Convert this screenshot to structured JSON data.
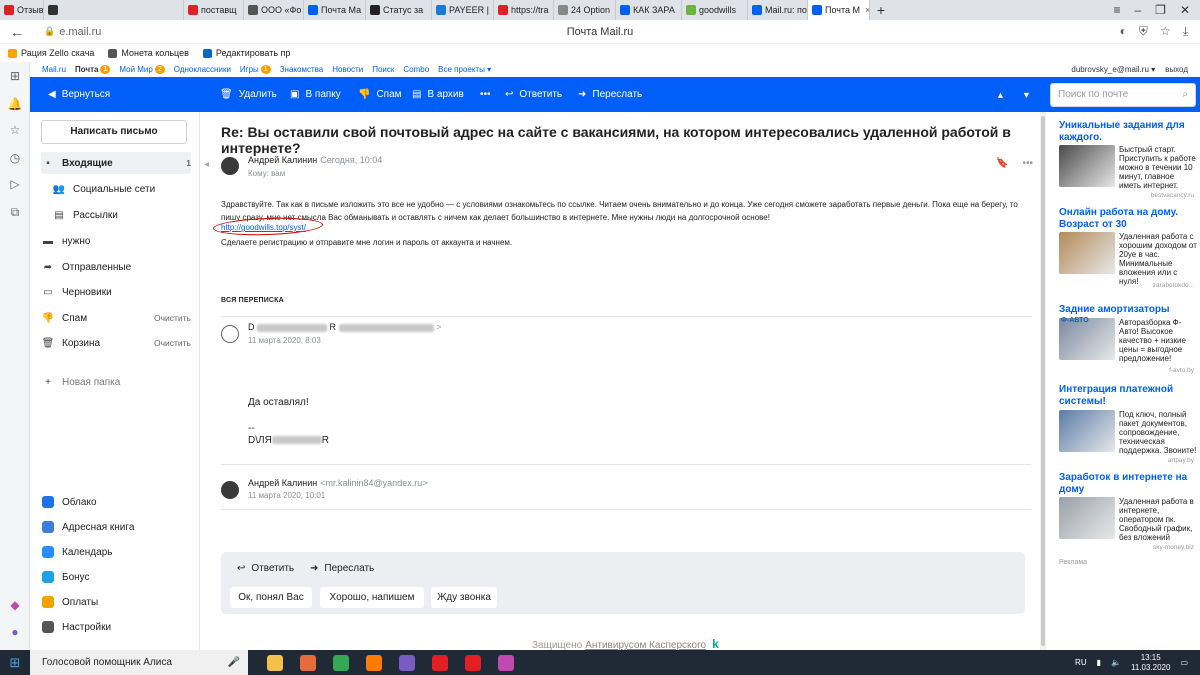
{
  "browser": {
    "tabs": [
      {
        "label": "Отзывы и",
        "color": "#e31e24"
      },
      {
        "label": "",
        "color": "#333333"
      },
      {
        "label": "поставщ",
        "color": "#e31e24"
      },
      {
        "label": "ООО «Фо",
        "color": "#555555"
      },
      {
        "label": "Почта Ма",
        "color": "#005ff9"
      },
      {
        "label": "Статус за",
        "color": "#222222"
      },
      {
        "label": "PAYEER |",
        "color": "#1a7bd6"
      },
      {
        "label": "https://tra",
        "color": "#e31e24"
      },
      {
        "label": "24 Option",
        "color": "#888888"
      },
      {
        "label": "КАК ЗАРА",
        "color": "#005ff9"
      },
      {
        "label": "goodwills",
        "color": "#6cb33f"
      },
      {
        "label": "Mail.ru: по",
        "color": "#005ff9"
      },
      {
        "label": "Почта М",
        "color": "#005ff9",
        "active": true
      }
    ],
    "url": "e.mail.ru",
    "page_title": "Почта Mail.ru",
    "bookmarks": [
      {
        "label": "Рация Zello скача",
        "color": "#f7a600"
      },
      {
        "label": "Монета кольцев",
        "color": "#555555"
      },
      {
        "label": "Редактировать пр",
        "color": "#0a66c2"
      }
    ]
  },
  "portal": {
    "links": [
      {
        "label": "Mail.ru",
        "badge": ""
      },
      {
        "label": "Почта",
        "badge": "1",
        "current": true
      },
      {
        "label": "Мой Мир",
        "badge": "2"
      },
      {
        "label": "Одноклассники",
        "badge": ""
      },
      {
        "label": "Игры",
        "badge": "1"
      },
      {
        "label": "Знакомства",
        "badge": ""
      },
      {
        "label": "Новости",
        "badge": ""
      },
      {
        "label": "Поиск",
        "badge": ""
      },
      {
        "label": "Combo",
        "badge": ""
      },
      {
        "label": "Все проекты ▾",
        "badge": ""
      }
    ],
    "account": "dubrovsky_e@mail.ru ▾",
    "logout": "выход"
  },
  "toolbar": {
    "back": "Вернуться",
    "delete": "Удалить",
    "to_folder": "В папку",
    "spam": "Спам",
    "archive": "В архив",
    "more": "•••",
    "reply": "Ответить",
    "forward": "Переслать",
    "search_placeholder": "Поиск по почте"
  },
  "nav": {
    "compose": "Написать письмо",
    "folders": [
      {
        "label": "Входящие",
        "count": "1",
        "icon": "▪",
        "selected": true
      },
      {
        "label": "Социальные сети",
        "count": "",
        "icon": "👥",
        "indent": true
      },
      {
        "label": "Рассылки",
        "count": "",
        "icon": "▤",
        "indent": true
      },
      {
        "label": "нужно",
        "count": "",
        "icon": "▬"
      },
      {
        "label": "Отправленные",
        "count": "",
        "icon": "➦"
      },
      {
        "label": "Черновики",
        "count": "",
        "icon": "▭"
      },
      {
        "label": "Спам",
        "count": "Очистить",
        "icon": "👎"
      },
      {
        "label": "Корзина",
        "count": "Очистить",
        "icon": "🗑"
      }
    ],
    "new_folder": "Новая папка",
    "services": [
      {
        "label": "Облако",
        "color": "#1a73e8"
      },
      {
        "label": "Адресная книга",
        "color": "#3b7ddd"
      },
      {
        "label": "Календарь",
        "color": "#2a8cff"
      },
      {
        "label": "Бонус",
        "color": "#1aa3e8"
      },
      {
        "label": "Оплаты",
        "color": "#f3a300"
      },
      {
        "label": "Настройки",
        "color": "#555555"
      }
    ]
  },
  "letter": {
    "subject": "Re: Вы оставили свой почтовый адрес на сайте с вакансиями, на котором интересовались удаленной работой в интернете?",
    "sender": "Андрей Калинин",
    "date": "Сегодня, 10:04",
    "to": "Кому: вам",
    "body1": "Здравствуйте. Так как в письме изложить это все не удобно — с условиями ознакомьтесь по ссылке. Читаем очень внимательно и до конца. Уже сегодня сможете заработать первые деньги. Пока еще на берегу, то пишу сразу, мне нет смысла Вас обманывать и оставлять с ничем как делает большинство в интернете. Мне нужны люди на долгосрочной основе!",
    "link": "http://goodwills.top/syst/",
    "body2": "Сделаете регистрацию и отправите мне логин и пароль от аккаунта и начнем.",
    "all_correspondence": "ВСЯ ПЕРЕПИСКА",
    "thread": [
      {
        "sender_start": "D",
        "sender_mid": "R",
        "date": "11 марта 2020, 8:03",
        "text": "Да оставлял!",
        "sig1": "--",
        "sig2_start": "D\\ЛЯ",
        "sig2_end": "R"
      },
      {
        "sender": "Андрей Калинин",
        "email": "<mr.kalinin84@yandex.ru>",
        "date": "11 марта 2020, 10:01"
      }
    ],
    "reply": "Ответить",
    "forward": "Переслать",
    "quick_replies": [
      "Ок, понял Вас",
      "Хорошо, напишем",
      "Жду звонка"
    ],
    "protected": "Защищено",
    "antivirus": "Антивирусом Касперского"
  },
  "ads": [
    {
      "title": "Уникальные задания для каждого.",
      "text": "Быстрый старт. Приступить к работе можно в течении 10 минут, главное иметь интернет.",
      "source": "bestvacancy.ru",
      "color": "#4a4a4a"
    },
    {
      "title": "Онлайн работа на дому. Возраст от 30",
      "text": "Удаленная работа с хорошим доходом от 20уе в час. Минимальные вложения или с нуля!",
      "source": "zarabotokdo...",
      "color": "#b38a5a"
    },
    {
      "title": "Задние амортизаторы",
      "text": "Авторазборка Ф-Авто! Высокое качество + низкие цены = выгодное предложение!",
      "source": "f-avto.by",
      "color": "#7a8aa0",
      "brand": "Ф-АВТО"
    },
    {
      "title": "Интеграция платежной системы!",
      "text": "Под ключ, полный пакет документов, сопровождение, техническая поддержка. Звоните!",
      "source": "artpay.by",
      "color": "#5a7ca8"
    },
    {
      "title": "Заработок в интернете на дому",
      "text": "Удаленная работа в интернете, оператором пк. Свободный график, без вложений",
      "source": "sky-money.biz",
      "color": "#9aa0a8"
    }
  ],
  "ads_label": "Реклама",
  "taskbar": {
    "search": "Голосовой помощник Алиса",
    "apps": [
      {
        "color": "#f3c04a"
      },
      {
        "color": "#e86b3a"
      },
      {
        "color": "#34a853"
      },
      {
        "color": "#ff7a00"
      },
      {
        "color": "#7a5cc0"
      },
      {
        "color": "#e31e24"
      },
      {
        "color": "#e31e24"
      },
      {
        "color": "#c04ab0"
      }
    ],
    "lang": "RU",
    "time": "13:15",
    "date": "11.03.2020"
  }
}
